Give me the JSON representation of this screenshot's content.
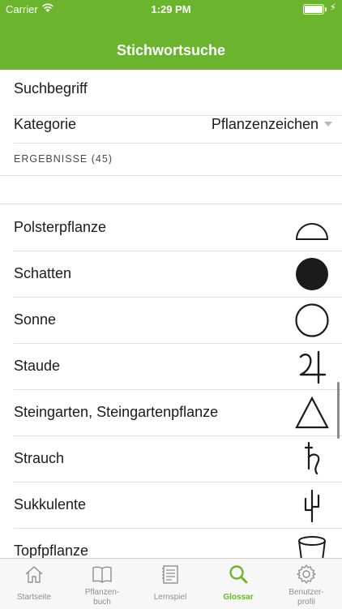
{
  "status_bar": {
    "carrier": "Carrier",
    "time": "1:29 PM"
  },
  "header": {
    "title": "Stichwortsuche"
  },
  "search": {
    "label": "Suchbegriff"
  },
  "category": {
    "label": "Kategorie",
    "value": "Pflanzenzeichen"
  },
  "results": {
    "header": "ERGEBNISSE (45)"
  },
  "items": [
    {
      "name": "Polsterpflanze",
      "icon": "dome-symbol-icon"
    },
    {
      "name": "Schatten",
      "icon": "filled-circle-icon"
    },
    {
      "name": "Sonne",
      "icon": "circle-outline-icon"
    },
    {
      "name": "Staude",
      "icon": "jupiter-symbol-icon"
    },
    {
      "name": "Steingarten, Steingartenpflanze",
      "icon": "triangle-icon"
    },
    {
      "name": "Strauch",
      "icon": "saturn-symbol-icon"
    },
    {
      "name": "Sukkulente",
      "icon": "cactus-icon"
    },
    {
      "name": "Topfpflanze",
      "icon": "pot-icon"
    }
  ],
  "tabs": [
    {
      "label": "Startseite",
      "icon": "home-icon"
    },
    {
      "label": "Pflanzen-\nbuch",
      "icon": "book-icon"
    },
    {
      "label": "Lernspiel",
      "icon": "notepad-icon"
    },
    {
      "label": "Glossar",
      "icon": "search-icon",
      "active": true
    },
    {
      "label": "Benutzer-\nprofil",
      "icon": "gear-icon"
    }
  ],
  "colors": {
    "brand_green": "#6bb42e",
    "inactive_gray": "#8e8e8e"
  }
}
